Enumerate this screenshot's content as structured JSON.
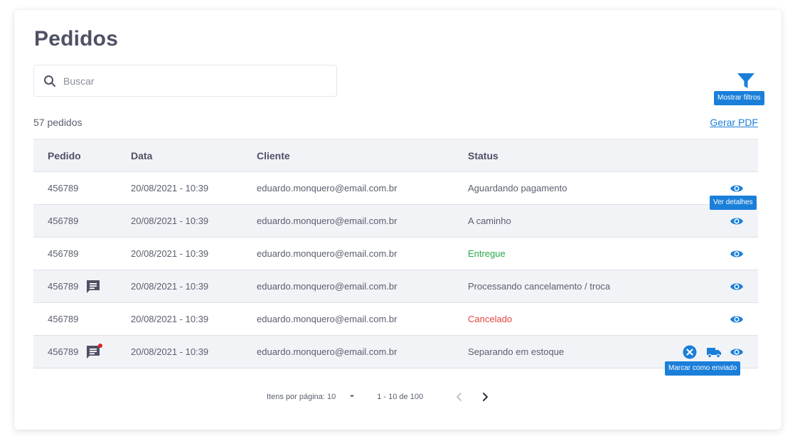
{
  "page": {
    "title": "Pedidos"
  },
  "search": {
    "placeholder": "Buscar"
  },
  "filters": {
    "tooltip": "Mostrar filtros"
  },
  "summary": {
    "count_text": "57 pedidos",
    "pdf_link": "Gerar PDF"
  },
  "table": {
    "headers": {
      "pedido": "Pedido",
      "data": "Data",
      "cliente": "Cliente",
      "status": "Status"
    },
    "rows": [
      {
        "pedido": "456789",
        "data": "20/08/2021 - 10:39",
        "cliente": "eduardo.monquero@email.com.br",
        "status": "Aguardando pagamento"
      },
      {
        "pedido": "456789",
        "data": "20/08/2021 - 10:39",
        "cliente": "eduardo.monquero@email.com.br",
        "status": "A caminho"
      },
      {
        "pedido": "456789",
        "data": "20/08/2021 - 10:39",
        "cliente": "eduardo.monquero@email.com.br",
        "status": "Entregue"
      },
      {
        "pedido": "456789",
        "data": "20/08/2021 - 10:39",
        "cliente": "eduardo.monquero@email.com.br",
        "status": "Processando cancelamento / troca"
      },
      {
        "pedido": "456789",
        "data": "20/08/2021 - 10:39",
        "cliente": "eduardo.monquero@email.com.br",
        "status": "Cancelado"
      },
      {
        "pedido": "456789",
        "data": "20/08/2021 - 10:39",
        "cliente": "eduardo.monquero@email.com.br",
        "status": "Separando em estoque"
      }
    ]
  },
  "tooltips": {
    "view_details": "Ver detalhes",
    "mark_shipped": "Marcar como enviado"
  },
  "pagination": {
    "per_page_label": "Itens por página: 10",
    "range": "1 - 10 de 100"
  },
  "colors": {
    "accent": "#1a7fd9",
    "status_delivered": "#2aa84a",
    "status_cancelled": "#e0453a",
    "notification_dot": "#e02020",
    "header_bg": "#f2f3f7"
  },
  "icons": [
    "search-icon",
    "filter-icon",
    "message-icon",
    "eye-icon",
    "cancel-icon",
    "truck-icon",
    "chevron-down-icon",
    "chevron-left-icon",
    "chevron-right-icon"
  ]
}
